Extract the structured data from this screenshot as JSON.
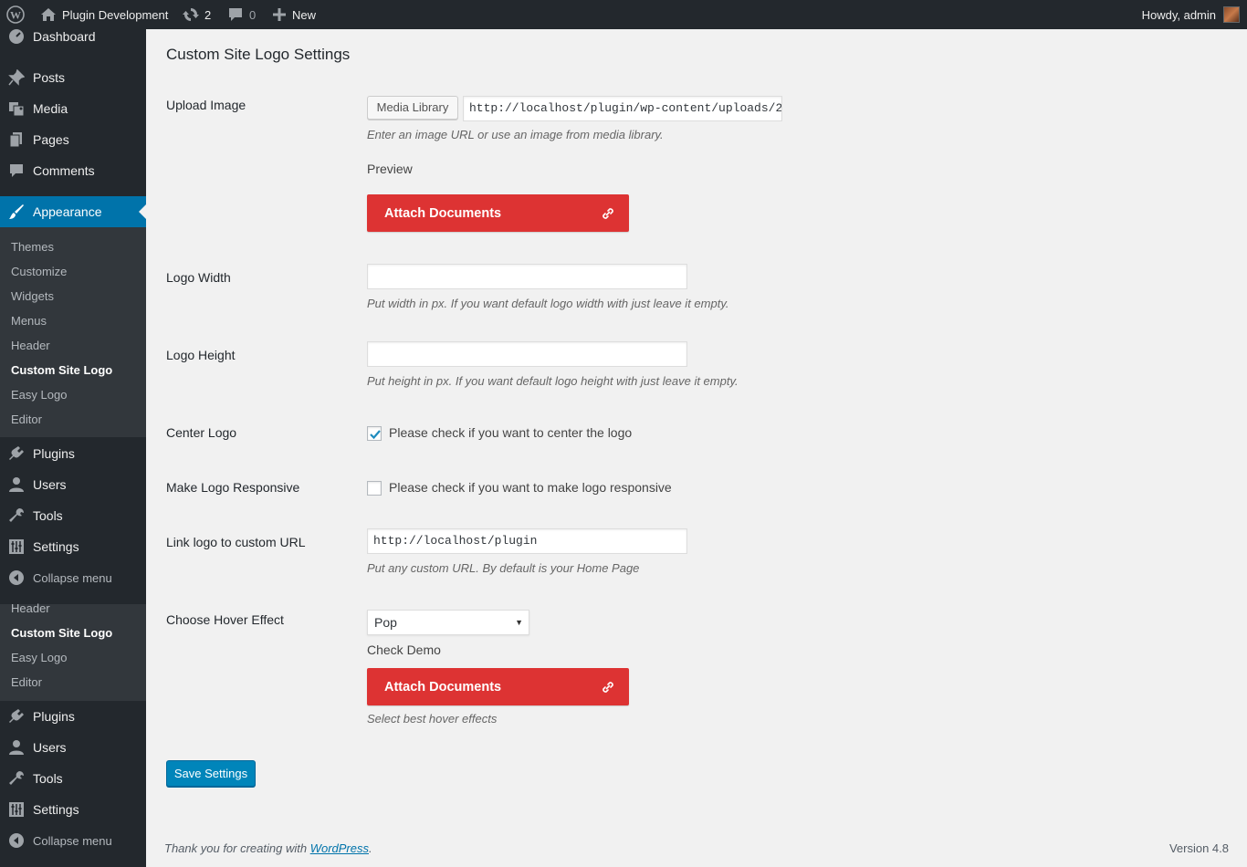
{
  "adminbar": {
    "site_name": "Plugin Development",
    "updates_count": "2",
    "comments_count": "0",
    "new_label": "New",
    "account_greeting": "Howdy, admin"
  },
  "sidebar": {
    "dashboard": "Dashboard",
    "posts": "Posts",
    "media": "Media",
    "pages": "Pages",
    "comments": "Comments",
    "appearance": "Appearance",
    "appearance_sub": [
      "Themes",
      "Customize",
      "Widgets",
      "Menus",
      "Header",
      "Custom Site Logo",
      "Easy Logo",
      "Editor"
    ],
    "plugins": "Plugins",
    "users": "Users",
    "tools": "Tools",
    "settings": "Settings",
    "collapse": "Collapse menu",
    "repeat_sub": [
      "Header",
      "Custom Site Logo",
      "Easy Logo",
      "Editor"
    ]
  },
  "page": {
    "title": "Custom Site Logo Settings",
    "upload_label": "Upload Image",
    "media_library_button": "Media Library",
    "image_url": "http://localhost/plugin/wp-content/uploads/2",
    "upload_desc": "Enter an image URL or use an image from media library.",
    "preview_label": "Preview",
    "attach_label": "Attach Documents",
    "logo_width_label": "Logo Width",
    "logo_width_value": "",
    "logo_width_desc": "Put width in px. If you want default logo width with just leave it empty.",
    "logo_height_label": "Logo Height",
    "logo_height_value": "",
    "logo_height_desc": "Put height in px. If you want default logo height with just leave it empty.",
    "center_label": "Center Logo",
    "center_checked": true,
    "center_text": "Please check if you want to center the logo",
    "responsive_label": "Make Logo Responsive",
    "responsive_checked": false,
    "responsive_text": "Please check if you want to make logo responsive",
    "link_label": "Link logo to custom URL",
    "link_value": "http://localhost/plugin",
    "link_desc": "Put any custom URL. By default is your Home Page",
    "hover_label": "Choose Hover Effect",
    "hover_selected": "Pop",
    "check_demo": "Check Demo",
    "hover_desc": "Select best hover effects",
    "save_button": "Save Settings"
  },
  "footer": {
    "thanks_prefix": "Thank you for creating with ",
    "thanks_link": "WordPress",
    "thanks_suffix": ".",
    "version": "Version 4.8"
  },
  "colors": {
    "adminbar_bg": "#23282d",
    "accent": "#0073aa",
    "attach_red": "#dd3333",
    "save_blue": "#0085ba"
  }
}
